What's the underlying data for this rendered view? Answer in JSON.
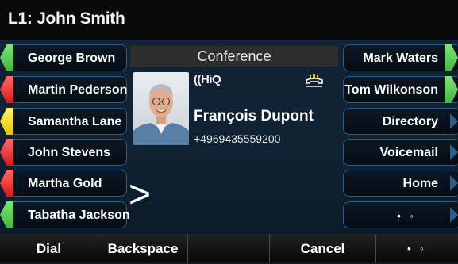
{
  "header": {
    "title": "L1: John Smith"
  },
  "left_keys": [
    {
      "label": "George Brown",
      "status": "green"
    },
    {
      "label": "Martin Pederson",
      "status": "red"
    },
    {
      "label": "Samantha Lane",
      "status": "yellow"
    },
    {
      "label": "John Stevens",
      "status": "red"
    },
    {
      "label": "Martha Gold",
      "status": "red"
    },
    {
      "label": "Tabatha Jackson",
      "status": "green"
    }
  ],
  "right_keys": [
    {
      "label": "Mark Waters",
      "status": "green"
    },
    {
      "label": "Tom Wilkonson",
      "status": "green"
    },
    {
      "label": "Directory"
    },
    {
      "label": "Voicemail"
    },
    {
      "label": "Home"
    },
    {
      "label": "• ◦"
    }
  ],
  "call": {
    "mode": "Conference",
    "codec": "((HiQ",
    "caller_name": "François Dupont",
    "caller_number": "+4969435559200",
    "prompt": ">"
  },
  "softkeys": [
    "Dial",
    "Backspace",
    "",
    "Cancel",
    "• ◦"
  ],
  "colors": {
    "green": "#3fb83a",
    "red": "#d61a1a",
    "yellow": "#e4c600",
    "frame": "#2a5e88"
  }
}
